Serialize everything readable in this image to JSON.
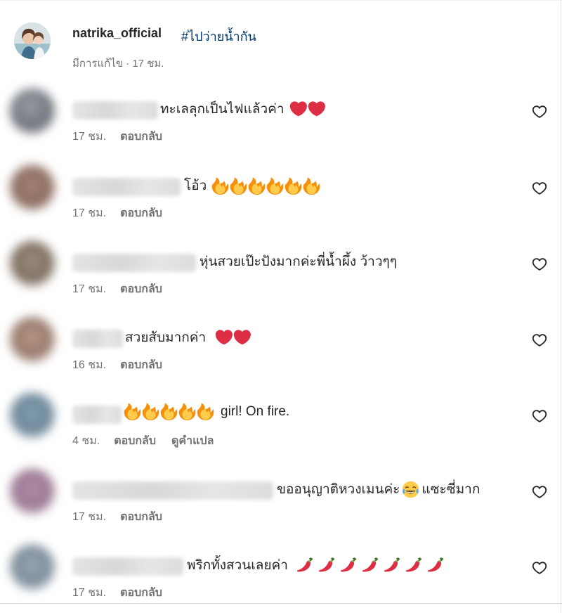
{
  "caption": {
    "username": "natrika_official",
    "hashtag": "#ไปว่ายน้ำกัน",
    "edited": "มีการแก้ไข",
    "separator": " · ",
    "time": "17 ชม."
  },
  "comments": [
    {
      "text": "ทะเลลุกเป็นไฟแล้วค่า",
      "emojis": [
        "heart",
        "heart"
      ],
      "emojis_after": true,
      "time": "17 ชม.",
      "reply": "ตอบกลับ"
    },
    {
      "text": "โอ้ว",
      "emojis": [
        "fire",
        "fire",
        "fire",
        "fire",
        "fire",
        "fire"
      ],
      "emojis_after": true,
      "time": "17 ชม.",
      "reply": "ตอบกลับ"
    },
    {
      "text": "หุ่นสวยเป๊ะปังมากค่ะพี่น้ำผึ้ง ว้าวๆๆ",
      "emojis": [],
      "time": "17 ชม.",
      "reply": "ตอบกลับ"
    },
    {
      "text": "สวยสับมากค่า",
      "emojis": [
        "heart",
        "heart"
      ],
      "emojis_after": true,
      "time": "16 ชม.",
      "reply": "ตอบกลับ"
    },
    {
      "text": "girl! On fire.",
      "emojis": [
        "fire",
        "fire",
        "fire",
        "fire",
        "fire"
      ],
      "emojis_after": false,
      "time": "4 ชม.",
      "reply": "ตอบกลับ",
      "translate": "ดูคำแปล"
    },
    {
      "text": "ขออนุญาติหวงเมนค่ะ",
      "text_after": "แซะซี่มาก",
      "emojis": [
        "tears-of-joy"
      ],
      "emojis_after": true,
      "time": "17 ชม.",
      "reply": "ตอบกลับ"
    },
    {
      "text": "พริกทั้งสวนเลยค่า",
      "emojis": [
        "chili",
        "chili",
        "chili",
        "chili",
        "chili",
        "chili",
        "chili"
      ],
      "emojis_after": true,
      "time": "17 ชม.",
      "reply": "ตอบกลับ"
    }
  ],
  "colors": {
    "text": "#262626",
    "muted": "#737373",
    "link": "#00376b",
    "heart_emoji": "#dd2e44",
    "fire_emoji": "#f4900c"
  }
}
